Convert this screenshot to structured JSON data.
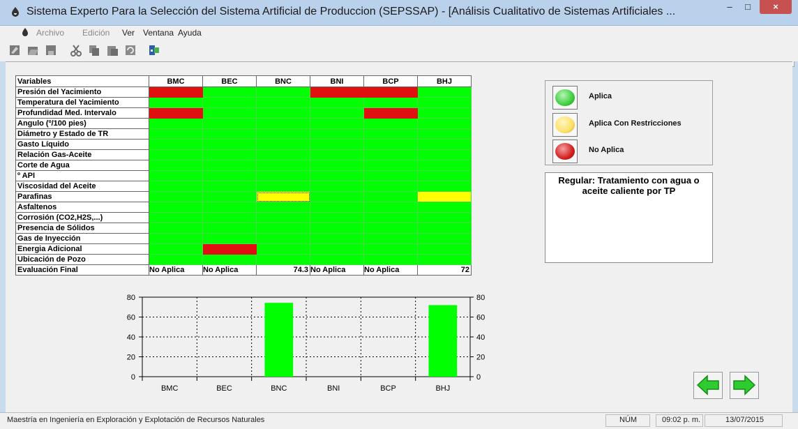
{
  "window": {
    "title": "Sistema Experto Para la Selección del Sistema Artificial de Produccion (SEPSSAP) - [Análisis Cualitativo de Sistemas Artificiales ...",
    "controls": {
      "minimize": "–",
      "maximize": "□",
      "close": "×"
    }
  },
  "menu": {
    "items": [
      "Archivo",
      "Edición",
      "Ver",
      "Ventana",
      "Ayuda"
    ],
    "mdi": {
      "minimize": "_",
      "restore": "▭",
      "close": "×"
    }
  },
  "toolbar": {
    "icons": [
      "new-icon",
      "open-icon",
      "save-icon",
      "cut-icon",
      "copy-icon",
      "paste-icon",
      "undo-icon",
      "exit-icon"
    ]
  },
  "matrix": {
    "header_label": "Variables",
    "columns": [
      "BMC",
      "BEC",
      "BNC",
      "BNI",
      "BCP",
      "BHJ"
    ],
    "rows": [
      {
        "label": "Presión del Yacimiento",
        "cells": [
          "No Aplica",
          "Aplica",
          "Aplica",
          "No Aplica",
          "No Aplica",
          "Aplica"
        ]
      },
      {
        "label": "Temperatura del Yacimiento",
        "cells": [
          "Aplica",
          "Aplica",
          "Aplica",
          "Aplica",
          "Aplica",
          "Aplica"
        ]
      },
      {
        "label": "Profundidad Med. Intervalo",
        "cells": [
          "No Aplica",
          "Aplica",
          "Aplica",
          "Aplica",
          "No Aplica",
          "Aplica"
        ]
      },
      {
        "label": "Angulo (º/100 pies)",
        "cells": [
          "Aplica",
          "Aplica",
          "Aplica",
          "Aplica",
          "Aplica",
          "Aplica"
        ]
      },
      {
        "label": "Diámetro y Estado de TR",
        "cells": [
          "Aplica",
          "Aplica",
          "Aplica",
          "Aplica",
          "Aplica",
          "Aplica"
        ]
      },
      {
        "label": "Gasto Líquido",
        "cells": [
          "Aplica",
          "Aplica",
          "Aplica",
          "Aplica",
          "Aplica",
          "Aplica"
        ]
      },
      {
        "label": "Relación Gas-Aceite",
        "cells": [
          "Aplica",
          "Aplica",
          "Aplica",
          "Aplica",
          "Aplica",
          "Aplica"
        ]
      },
      {
        "label": "Corte de Agua",
        "cells": [
          "Aplica",
          "Aplica",
          "Aplica",
          "Aplica",
          "Aplica",
          "Aplica"
        ]
      },
      {
        "label": "º API",
        "cells": [
          "Aplica",
          "Aplica",
          "Aplica",
          "Aplica",
          "Aplica",
          "Aplica"
        ]
      },
      {
        "label": "Viscosidad del Aceite",
        "cells": [
          "Aplica",
          "Aplica",
          "Aplica",
          "Aplica",
          "Aplica",
          "Aplica"
        ]
      },
      {
        "label": "Parafinas",
        "cells": [
          "Aplica",
          "Aplica",
          "Aplica Con Restricciones",
          "Aplica",
          "Aplica",
          "Aplica Con Restricciones"
        ]
      },
      {
        "label": "Asfaltenos",
        "cells": [
          "Aplica",
          "Aplica",
          "Aplica",
          "Aplica",
          "Aplica",
          "Aplica"
        ]
      },
      {
        "label": "Corrosión (CO2,H2S,...)",
        "cells": [
          "Aplica",
          "Aplica",
          "Aplica",
          "Aplica",
          "Aplica",
          "Aplica"
        ]
      },
      {
        "label": "Presencia de Sólidos",
        "cells": [
          "Aplica",
          "Aplica",
          "Aplica",
          "Aplica",
          "Aplica",
          "Aplica"
        ]
      },
      {
        "label": "Gas de Inyección",
        "cells": [
          "Aplica",
          "Aplica",
          "Aplica",
          "Aplica",
          "Aplica",
          "Aplica"
        ]
      },
      {
        "label": "Energia Adicional",
        "cells": [
          "Aplica",
          "No Aplica",
          "Aplica",
          "Aplica",
          "Aplica",
          "Aplica"
        ]
      },
      {
        "label": "Ubicación de Pozo",
        "cells": [
          "Aplica",
          "Aplica",
          "Aplica",
          "Aplica",
          "Aplica",
          "Aplica"
        ]
      }
    ],
    "final_label": "Evaluación Final",
    "final": [
      "No Aplica",
      "No Aplica",
      "74.3",
      "No Aplica",
      "No Aplica",
      "72"
    ],
    "selected_cell": {
      "row": 10,
      "col": 2
    }
  },
  "legend": {
    "items": [
      {
        "label": "Aplica",
        "color": "#3fcf3f"
      },
      {
        "label": "Aplica Con Restricciones",
        "color": "#ffe066"
      },
      {
        "label": "No Aplica",
        "color": "#d42020"
      }
    ]
  },
  "note": {
    "text": "Regular: Tratamiento con agua o aceite caliente por TP"
  },
  "chart_data": {
    "type": "bar",
    "categories": [
      "BMC",
      "BEC",
      "BNC",
      "BNI",
      "BCP",
      "BHJ"
    ],
    "values": [
      0,
      0,
      74.3,
      0,
      0,
      72
    ],
    "ylim": [
      0,
      80
    ],
    "yticks": [
      0,
      20,
      40,
      60,
      80
    ],
    "bar_color": "#00ff00",
    "grid": "dotted",
    "title": "",
    "xlabel": "",
    "ylabel": ""
  },
  "nav": {
    "back_icon": "arrow-left-icon",
    "forward_icon": "arrow-right-icon"
  },
  "status": {
    "left": "Maestría en Ingeniería en Exploración y Explotación de Recursos Naturales",
    "num": "NÚM",
    "time": "09:02 p. m.",
    "date": "13/07/2015"
  },
  "colors": {
    "aplica": "#00ff00",
    "restricciones": "#ffff00",
    "no_aplica": "#e01010"
  }
}
